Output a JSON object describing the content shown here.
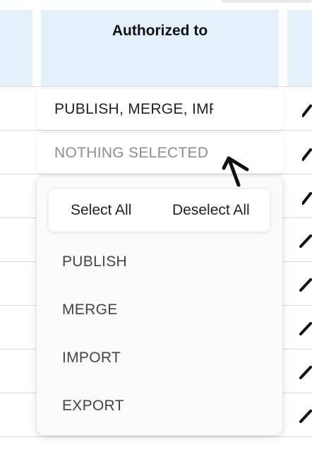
{
  "table": {
    "column_header": "Authorized to"
  },
  "rows": [
    {
      "authorized_value": "PUBLISH, MERGE, IMPORT"
    },
    {
      "authorized_placeholder": "NOTHING SELECTED"
    }
  ],
  "dropdown": {
    "select_all_label": "Select All",
    "deselect_all_label": "Deselect All",
    "options": [
      "PUBLISH",
      "MERGE",
      "IMPORT",
      "EXPORT"
    ]
  },
  "colors": {
    "header_bg": "#e4f1fb",
    "placeholder_text": "#8e8e8e"
  },
  "icons": {
    "row_action": "edit-icon",
    "pointer": "mouse-cursor-icon"
  }
}
